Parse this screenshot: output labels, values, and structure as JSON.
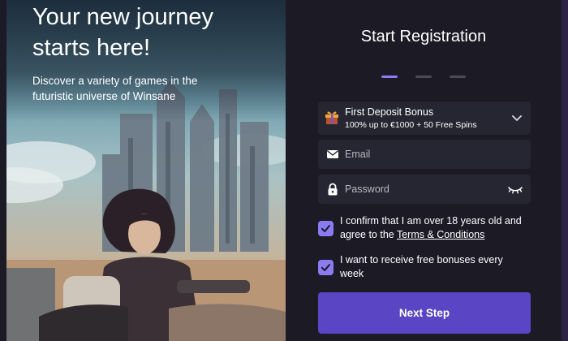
{
  "hero": {
    "title_line1": "Your new journey",
    "title_line2": "starts here!",
    "subtitle_line1": "Discover a variety of games in the",
    "subtitle_line2": "futuristic universe of Winsane"
  },
  "form": {
    "title": "Start Registration",
    "steps": {
      "total": 3,
      "current": 1
    },
    "bonus": {
      "icon": "gift-icon",
      "title": "First Deposit Bonus",
      "detail": "100% up to €1000 + 50 Free Spins"
    },
    "email": {
      "placeholder": "Email",
      "value": ""
    },
    "password": {
      "placeholder": "Password",
      "value": ""
    },
    "consent_age": {
      "checked": true,
      "text_line1": "I confirm that I am over 18 years old and",
      "text_prefix": "agree to the ",
      "link": "Terms & Conditions"
    },
    "consent_bonus": {
      "checked": true,
      "text_line1": "I want to receive free bonuses every",
      "text_line2": "week"
    },
    "next_label": "Next Step"
  },
  "colors": {
    "background": "#1b1a25",
    "field": "#252631",
    "accent": "#8b7bf0",
    "button": "#5a45c4"
  }
}
